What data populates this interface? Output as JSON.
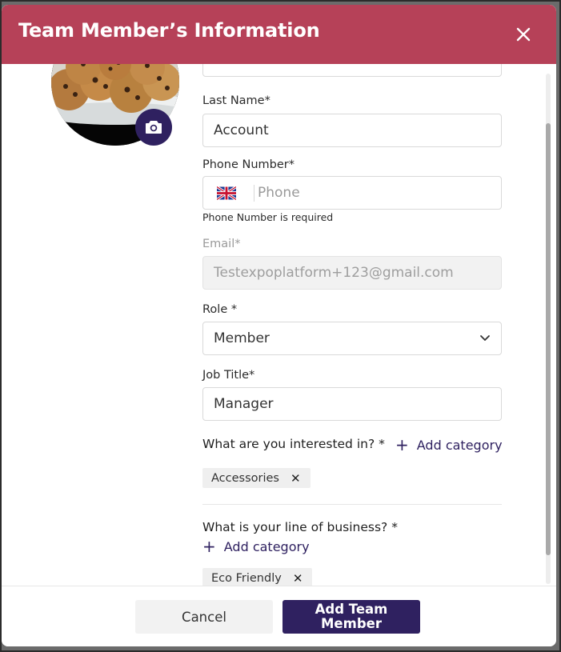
{
  "modal": {
    "title": "Team Member’s Information",
    "close_icon": "close-icon"
  },
  "avatar": {
    "alt": "cookies-photo",
    "camera_icon": "camera-icon"
  },
  "fields": {
    "last_name": {
      "label": "Last Name",
      "required": "*",
      "value": "Account"
    },
    "phone": {
      "label": "Phone Number",
      "required": "*",
      "flag_icon": "uk-flag-icon",
      "placeholder": "Phone",
      "error": "Phone Number is required"
    },
    "email": {
      "label": "Email",
      "required": "*",
      "value": "Testexpoplatform+123@gmail.com"
    },
    "role": {
      "label": "Role",
      "required": " *",
      "value": "Member",
      "icon": "chevron-down-icon"
    },
    "job_title": {
      "label": "Job Title",
      "required": "*",
      "value": "Manager"
    }
  },
  "interests": {
    "question": "What are you interested in? *",
    "add_label": "Add category",
    "chips": [
      "Accessories"
    ]
  },
  "business": {
    "question": "What is your line of business? *",
    "add_label": "Add category",
    "chips": [
      "Eco Friendly"
    ]
  },
  "footer": {
    "cancel_label": "Cancel",
    "submit_label": "Add Team Member"
  },
  "colors": {
    "header_bg": "#b64158",
    "accent": "#2f2160"
  }
}
